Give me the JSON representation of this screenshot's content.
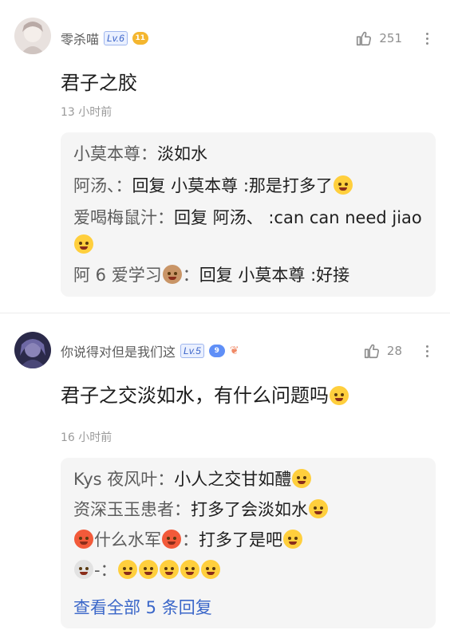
{
  "comments": [
    {
      "username": "零杀喵",
      "level": "Lv.6",
      "badge": "11",
      "likes": "251",
      "content": "君子之胶",
      "time": "13 小时前",
      "replies": [
        {
          "name": "小莫本尊",
          "sep": "：",
          "text": "淡如水",
          "emoji": ""
        },
        {
          "name": "阿汤、",
          "sep": "：",
          "text": "回复 小莫本尊 :那是打多了",
          "emoji": "yum-face"
        },
        {
          "name": "爱喝梅鼠汁",
          "sep": "：",
          "text": "回复 阿汤、 :can can need jiao",
          "emoji": "heart-eyes-face"
        },
        {
          "name": "阿 6 爱学习",
          "sep": "：",
          "text": "回复 小莫本尊 :好接",
          "emoji": "see-no-evil-monkey"
        }
      ]
    },
    {
      "username": "你说得对但是我们这",
      "level": "Lv.5",
      "badge": "9",
      "likes": "28",
      "content": "君子之交淡如水，有什么问题吗",
      "time": "16 小时前",
      "replies": [
        {
          "name": "Kys 夜风叶",
          "sep": "：",
          "text": "小人之交甘如醴",
          "emoji": "yum-face"
        },
        {
          "name": "资深玉玉患者",
          "sep": "：",
          "text": "打多了会淡如水",
          "emoji": "wavy-face"
        },
        {
          "name": "什么水军",
          "sep": "：",
          "text": "打多了是吧",
          "emoji": "grin-face"
        },
        {
          "name": "-",
          "sep": "：",
          "text": "",
          "emoji": "grin-face x5"
        }
      ],
      "view_all": "查看全部 5 条回复"
    }
  ]
}
